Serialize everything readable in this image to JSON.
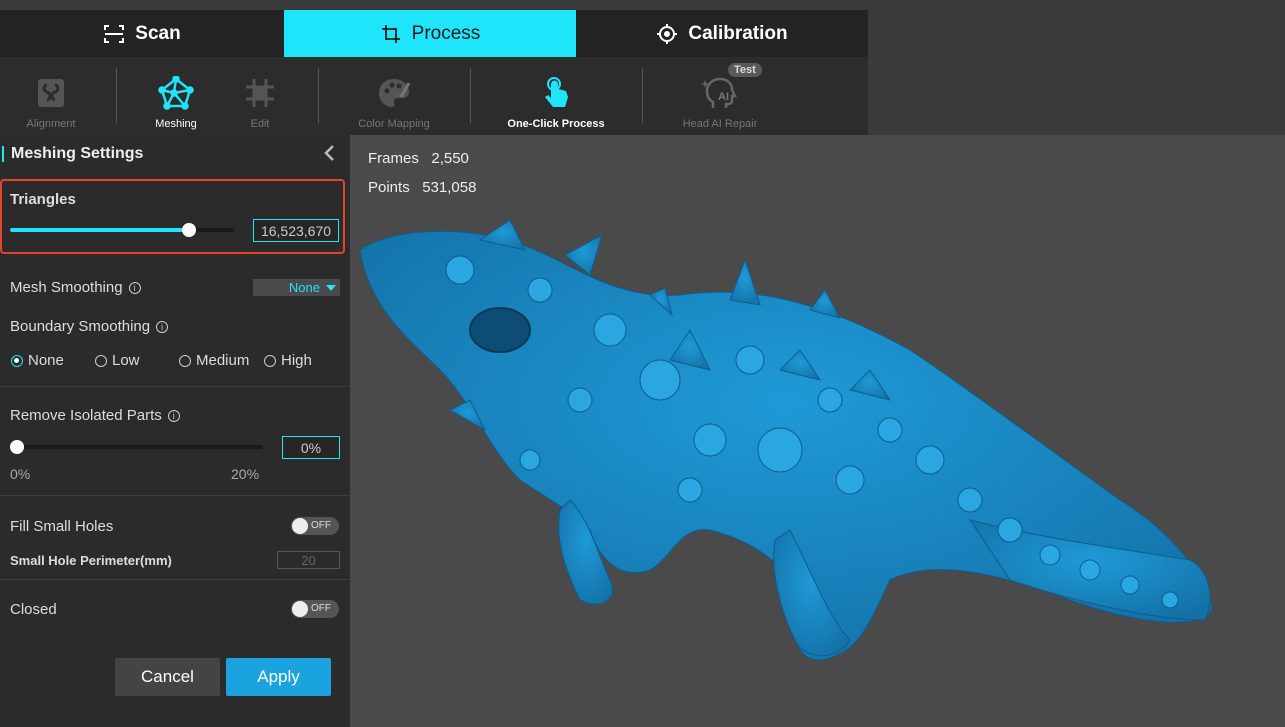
{
  "main_tabs": [
    {
      "label": "Scan",
      "icon": "scan-frame-icon"
    },
    {
      "label": "Process",
      "icon": "crop-icon",
      "active": true
    },
    {
      "label": "Calibration",
      "icon": "crosshair-icon"
    }
  ],
  "toolbar": {
    "alignment": "Alignment",
    "meshing": "Meshing",
    "edit": "Edit",
    "color_mapping": "Color Mapping",
    "one_click": "One-Click Process",
    "head_ai": "Head AI Repair",
    "test_badge": "Test"
  },
  "panel": {
    "title": "Meshing Settings",
    "triangles": {
      "label": "Triangles",
      "value": "16,523,670",
      "slider_fraction": 0.8
    },
    "mesh_smoothing": {
      "label": "Mesh Smoothing",
      "selected": "None"
    },
    "boundary_smoothing": {
      "label": "Boundary Smoothing",
      "options": [
        "None",
        "Low",
        "Medium",
        "High"
      ],
      "selected": "None"
    },
    "remove_isolated": {
      "label": "Remove Isolated Parts",
      "value": "0%",
      "min_label": "0%",
      "max_label": "20%",
      "slider_fraction": 0.0
    },
    "fill_holes": {
      "label": "Fill Small Holes",
      "state": "OFF"
    },
    "hole_perimeter": {
      "label": "Small Hole Perimeter(mm)",
      "value": "20"
    },
    "closed": {
      "label": "Closed",
      "state": "OFF"
    },
    "cancel": "Cancel",
    "apply": "Apply"
  },
  "viewport": {
    "frames_label": "Frames",
    "frames_value": "2,550",
    "points_label": "Points",
    "points_value": "531,058"
  },
  "colors": {
    "accent": "#1ee5fa",
    "apply": "#1ba3e0",
    "model": "#1a8cc8",
    "highlight": "#e2452c"
  }
}
